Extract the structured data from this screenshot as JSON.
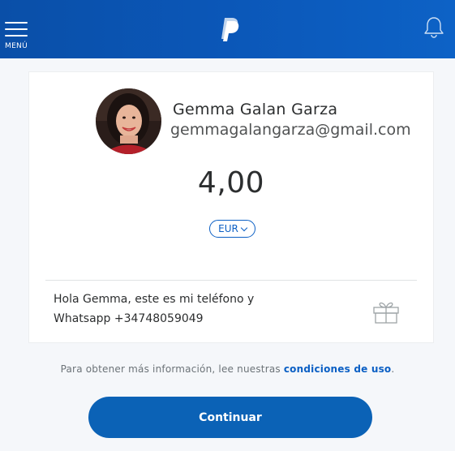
{
  "header": {
    "menu_label": "MENÚ",
    "logo_icon": "paypal-logo",
    "notification_icon": "bell-icon"
  },
  "recipient": {
    "name": "Gemma Galan Garza",
    "email": "gemmagalangarza@gmail.com"
  },
  "payment": {
    "amount": "4,00",
    "currency": "EUR"
  },
  "note": {
    "text": "Hola Gemma, este es mi teléfono y Whatsapp +34748059049",
    "gift_icon": "gift-icon"
  },
  "footer": {
    "terms_text": "Para obtener más información, lee nuestras ",
    "terms_link": "condiciones de uso",
    "terms_end": ".",
    "continue_label": "Continuar"
  },
  "colors": {
    "brand_blue": "#0b62b6",
    "header_blue": "#0b57b8",
    "link_blue": "#0b5fc4"
  }
}
